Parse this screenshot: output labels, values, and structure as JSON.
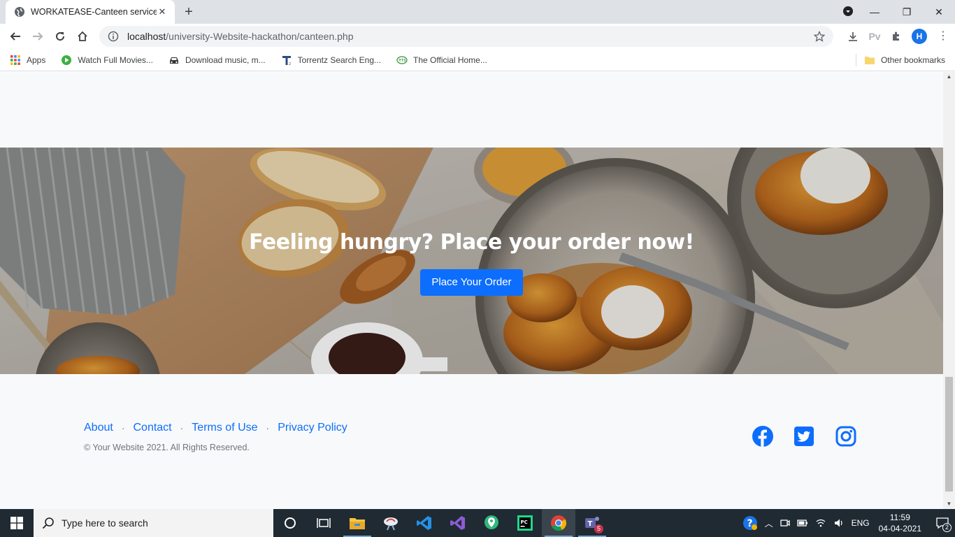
{
  "browser": {
    "tab_title": "WORKATEASE-Canteen service",
    "url_host": "localhost",
    "url_path": "/university-Website-hackathon/canteen.php",
    "profile_initial": "H",
    "ext_label": "Pv",
    "bookmarks": [
      {
        "label": "Apps",
        "icon": "apps-grid-icon"
      },
      {
        "label": "Watch Full Movies...",
        "icon": "play-icon"
      },
      {
        "label": "Download music, m...",
        "icon": "car-icon"
      },
      {
        "label": "Torrentz Search Eng...",
        "icon": "torrentz-icon"
      },
      {
        "label": "The Official Home...",
        "icon": "yts-icon"
      }
    ],
    "other_bookmarks": "Other bookmarks"
  },
  "hero": {
    "heading": "Feeling hungry? Place your order now!",
    "button": "Place Your Order"
  },
  "footer": {
    "links": [
      "About",
      "Contact",
      "Terms of Use",
      "Privacy Policy"
    ],
    "copyright": "© Your Website 2021. All Rights Reserved.",
    "social": [
      "facebook-icon",
      "twitter-icon",
      "instagram-icon"
    ]
  },
  "taskbar": {
    "search_placeholder": "Type here to search",
    "language": "ENG",
    "time": "11:59",
    "date": "04-04-2021",
    "notification_count": "2",
    "teams_badge": "5"
  },
  "colors": {
    "accent": "#0d6efd",
    "taskbar": "#1f2a33",
    "page_bg": "#f8f9fa"
  }
}
